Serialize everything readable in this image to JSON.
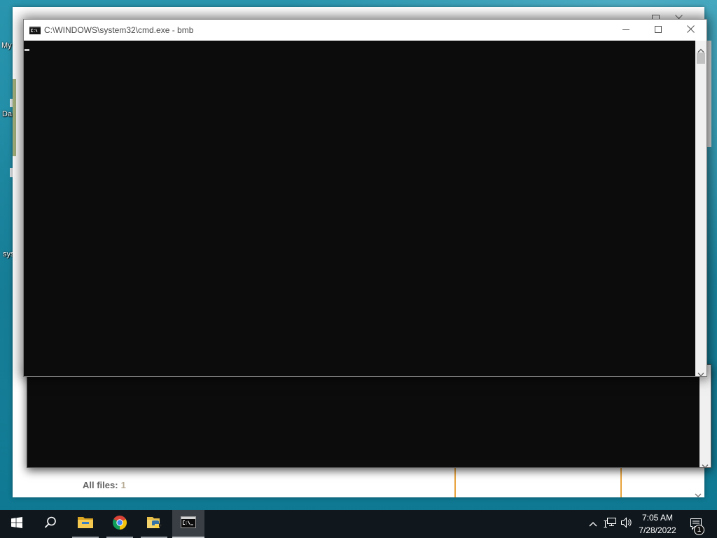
{
  "colors": {
    "desktop_top": "#2a95ae",
    "desktop_bottom": "#0d7690",
    "console_background": "#0c0c0c",
    "taskbar_background": "#10181e",
    "divider_orange": "#e8a33c"
  },
  "desktop": {
    "icons": [
      {
        "label": "My"
      },
      {
        "label": "Da"
      },
      {
        "label": "sys"
      }
    ]
  },
  "background_window": {
    "controls": [
      "maximize-icon",
      "close-icon"
    ],
    "all_files_label": "All files:",
    "all_files_count": "1"
  },
  "console_window": {
    "icon": "cmd-icon",
    "title": "C:\\WINDOWS\\system32\\cmd.exe - bmb",
    "controls": [
      "minimize-icon",
      "maximize-icon",
      "close-icon"
    ],
    "scrollbar": [
      "scroll-up-icon",
      "scroll-down-icon"
    ]
  },
  "background_console": {
    "scrollbar": [
      "scroll-down-icon"
    ]
  },
  "taskbar": {
    "items": [
      {
        "icon": "windows-start-icon"
      },
      {
        "icon": "search-icon"
      },
      {
        "icon": "file-explorer-icon",
        "running": true
      },
      {
        "icon": "chrome-icon",
        "running": true
      },
      {
        "icon": "python-icon",
        "running": true
      },
      {
        "icon": "cmd-icon",
        "running": true,
        "active": true
      }
    ],
    "tray": {
      "icons": [
        "chevron-up-icon",
        "network-icon",
        "volume-icon"
      ],
      "time": "7:05 AM",
      "date": "7/28/2022",
      "notification_icon": "notification-icon",
      "notification_count": "1"
    }
  }
}
